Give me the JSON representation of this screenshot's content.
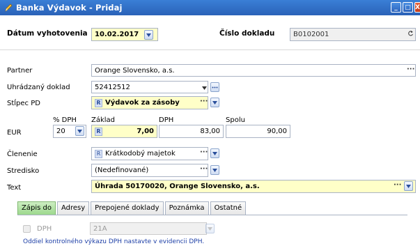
{
  "window": {
    "title": "Banka Výdavok - Pridaj",
    "min_label": "_",
    "max_label": "□",
    "close_label": "X"
  },
  "header": {
    "date_label": "Dátum vyhotovenia",
    "date_value": "10.02.2017",
    "docnum_label": "Číslo dokladu",
    "docnum_value": "B0102001"
  },
  "form": {
    "partner_label": "Partner",
    "partner_value": "Orange Slovensko, a.s.",
    "paid_doc_label": "Uhrádzaný doklad",
    "paid_doc_value": "52412512",
    "column_label": "Stĺpec PD",
    "column_badge": "R",
    "column_value": "Výdavok za zásoby",
    "currency_label": "EUR",
    "vat_pct_label": "% DPH",
    "vat_pct_value": "20",
    "base_label": "Základ",
    "base_badge": "R",
    "base_value": "7,00",
    "vat_label": "DPH",
    "vat_value": "83,00",
    "total_label": "Spolu",
    "total_value": "90,00",
    "division_label": "Členenie",
    "division_badge": "R",
    "division_value": "Krátkodobý majetok",
    "center_label": "Stredisko",
    "center_value": "(Nedefinované)",
    "text_label": "Text",
    "text_value": "Úhrada 50170020, Orange Slovensko, a.s.",
    "dots": "···"
  },
  "tabs": [
    "Zápis do",
    "Adresy",
    "Prepojené doklady",
    "Poznámka",
    "Ostatné"
  ],
  "tabpanel": {
    "dph_label": "DPH",
    "dph_value": "21A",
    "note": "Oddiel kontrolného výkazu DPH nastavte v evidencii DPH."
  }
}
